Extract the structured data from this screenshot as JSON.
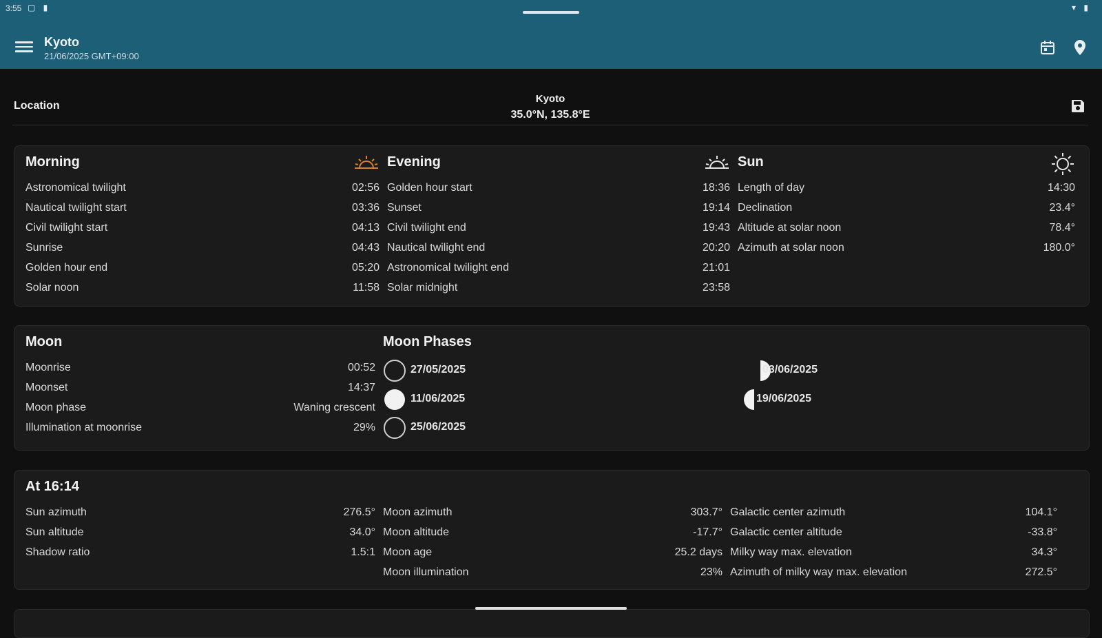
{
  "status_bar": {
    "time": "3:55",
    "left_icons": "▢ ▮",
    "right_icons": "▾ ▮"
  },
  "app_bar": {
    "title": "Kyoto",
    "subtitle": "21/06/2025 GMT+09:00",
    "menu_icon": "hamburger-icon",
    "calendar_icon": "calendar-icon",
    "location_icon": "map-pin-icon"
  },
  "location": {
    "label": "Location",
    "name": "Kyoto",
    "coords": "35.0°N, 135.8°E",
    "save_icon": "save-icon"
  },
  "morning": {
    "title": "Morning",
    "icon": "sunrise-icon",
    "rows": [
      {
        "label": "Astronomical twilight",
        "value": "02:56"
      },
      {
        "label": "Nautical twilight start",
        "value": "03:36"
      },
      {
        "label": "Civil twilight start",
        "value": "04:13"
      },
      {
        "label": "Sunrise",
        "value": "04:43"
      },
      {
        "label": "Golden hour end",
        "value": "05:20"
      },
      {
        "label": "Solar noon",
        "value": "11:58"
      }
    ]
  },
  "evening": {
    "title": "Evening",
    "icon": "sunset-icon",
    "rows": [
      {
        "label": "Golden hour start",
        "value": "18:36"
      },
      {
        "label": "Sunset",
        "value": "19:14"
      },
      {
        "label": "Civil twilight end",
        "value": "19:43"
      },
      {
        "label": "Nautical twilight end",
        "value": "20:20"
      },
      {
        "label": "Astronomical twilight end",
        "value": "21:01"
      },
      {
        "label": "Solar midnight",
        "value": "23:58"
      }
    ]
  },
  "sun": {
    "title": "Sun",
    "icon": "sun-icon",
    "rows": [
      {
        "label": "Length of day",
        "value": "14:30"
      },
      {
        "label": "Declination",
        "value": "23.4°"
      },
      {
        "label": "Altitude at solar noon",
        "value": "78.4°"
      },
      {
        "label": "Azimuth at solar noon",
        "value": "180.0°"
      }
    ]
  },
  "moon": {
    "title": "Moon",
    "icon": "crescent-moon-icon",
    "rows": [
      {
        "label": "Moonrise",
        "value": "00:52"
      },
      {
        "label": "Moonset",
        "value": "14:37"
      },
      {
        "label": "Moon phase",
        "value": "Waning crescent"
      },
      {
        "label": "Illumination at moonrise",
        "value": "29%"
      }
    ]
  },
  "moon_phases": {
    "title": "Moon Phases",
    "items": [
      {
        "icon": "new-moon-icon",
        "date": "27/05/2025"
      },
      {
        "icon": "first-quarter-icon",
        "date": "03/06/2025"
      },
      {
        "icon": "full-moon-icon",
        "date": "11/06/2025"
      },
      {
        "icon": "last-quarter-icon",
        "date": "19/06/2025"
      },
      {
        "icon": "new-moon-icon",
        "date": "25/06/2025"
      }
    ]
  },
  "at_time": {
    "title": "At 16:14",
    "col1": [
      {
        "label": "Sun azimuth",
        "value": "276.5°"
      },
      {
        "label": "Sun altitude",
        "value": "34.0°"
      },
      {
        "label": "Shadow ratio",
        "value": "1.5:1"
      }
    ],
    "col2": [
      {
        "label": "Moon azimuth",
        "value": "303.7°"
      },
      {
        "label": "Moon altitude",
        "value": "-17.7°"
      },
      {
        "label": "Moon age",
        "value": "25.2 days"
      },
      {
        "label": "Moon illumination",
        "value": "23%"
      }
    ],
    "col3": [
      {
        "label": "Galactic center azimuth",
        "value": "104.1°"
      },
      {
        "label": "Galactic center altitude",
        "value": "-33.8°"
      },
      {
        "label": "Milky way max. elevation",
        "value": "34.3°"
      },
      {
        "label": "Azimuth of milky way max. elevation",
        "value": "272.5°"
      }
    ]
  },
  "colors": {
    "app_bar": "#1e5f78",
    "background": "#101010",
    "card": "#1b1b1b",
    "sunrise_icon": "#d9802a"
  }
}
